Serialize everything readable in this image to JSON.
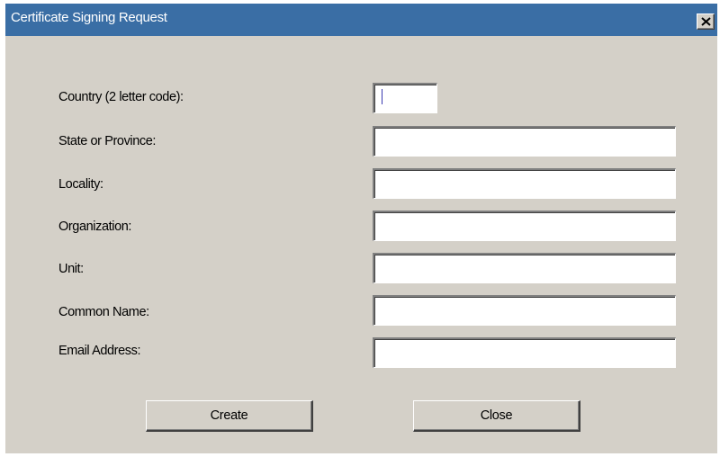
{
  "window": {
    "title": "Certificate Signing Request",
    "close_icon": "close-icon"
  },
  "form": {
    "fields": [
      {
        "label": "Country (2 letter code):",
        "value": ""
      },
      {
        "label": "State or Province:",
        "value": ""
      },
      {
        "label": "Locality:",
        "value": ""
      },
      {
        "label": "Organization:",
        "value": ""
      },
      {
        "label": "Unit:",
        "value": ""
      },
      {
        "label": "Common Name:",
        "value": ""
      },
      {
        "label": "Email Address:",
        "value": ""
      }
    ]
  },
  "buttons": {
    "create_label": "Create",
    "close_label": "Close"
  },
  "colors": {
    "titlebar": "#3a6ea5",
    "dialog_bg": "#d4d0c8",
    "title_text": "#ffffff"
  }
}
